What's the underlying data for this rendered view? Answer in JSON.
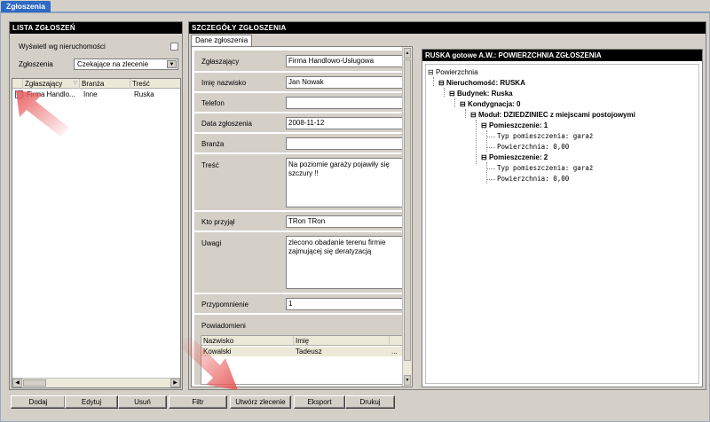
{
  "window": {
    "tab_title": "Zgłoszenia"
  },
  "left": {
    "title": "LISTA ZGŁOSZEŃ",
    "show_by_property_label": "Wyświetl wg nieruchomości",
    "filter_label": "Zgłoszenia",
    "filter_value": "Czekające na zlecenie",
    "columns": [
      "Zgłaszający",
      "Branża",
      "Treść"
    ],
    "rows": [
      {
        "zglaszajacy": "Firma Handlo...",
        "branza": "Inne",
        "tresc": "Ruska"
      }
    ]
  },
  "middle": {
    "title": "SZCZEGÓŁY ZGŁOSZENIA",
    "subtab": "Dane zgłoszenia",
    "fields": {
      "zglaszajacy": {
        "label": "Zgłaszający",
        "value": "Firma Handlowo-Usługowa"
      },
      "imie": {
        "label": "Imię nazwisko",
        "value": "Jan Nowak"
      },
      "telefon": {
        "label": "Telefon",
        "value": ""
      },
      "data": {
        "label": "Data zgłoszenia",
        "value": "2008-11-12"
      },
      "branza": {
        "label": "Branża",
        "value": ""
      },
      "tresc": {
        "label": "Treść",
        "value": "Na poziomie garaży pojawiły się szczury !!"
      },
      "kto": {
        "label": "Kto przyjął",
        "value": "TRon  TRon"
      },
      "uwagi": {
        "label": "Uwagi",
        "value": "zlecono obadanie terenu firmie zajmującej się deratyzacją"
      },
      "przyp": {
        "label": "Przypomnienie",
        "value": "1"
      }
    },
    "notifications": {
      "label": "Powiadomieni",
      "columns": [
        "Nazwisko",
        "Imię"
      ],
      "rows": [
        {
          "nazwisko": "Kowalski",
          "imie": "Tadeusz"
        }
      ],
      "more": "..."
    }
  },
  "tree": {
    "title": "RUSKA  gotowe A.W.: POWIERZCHNIA ZGŁOSZENIA",
    "root": "Powierzchnia",
    "property": "Nieruchomość: RUSKA",
    "building": "Budynek: Ruska",
    "floor": "Kondygnacja: 0",
    "module": "Moduł: DZIEDZINIEC z miejscami postojowymi",
    "rooms": [
      {
        "name": "Pomieszczenie: 1",
        "type": "Typ pomieszczenia: garaż",
        "area": "Powierzchnia: 0,00"
      },
      {
        "name": "Pomieszczenie: 2",
        "type": "Typ pomieszczenia: garaż",
        "area": "Powierzchnia: 0,00"
      }
    ]
  },
  "toolbar": {
    "add": "Dodaj",
    "edit": "Edytuj",
    "delete": "Usuń",
    "filter": "Filtr",
    "create_order": "Utwórz zlecenie",
    "export": "Eksport",
    "print": "Drukuj"
  },
  "colors": {
    "accent_tab": "#2f6bc4",
    "title_bar": "#000000",
    "annotation_arrow": "#e85a5a"
  }
}
